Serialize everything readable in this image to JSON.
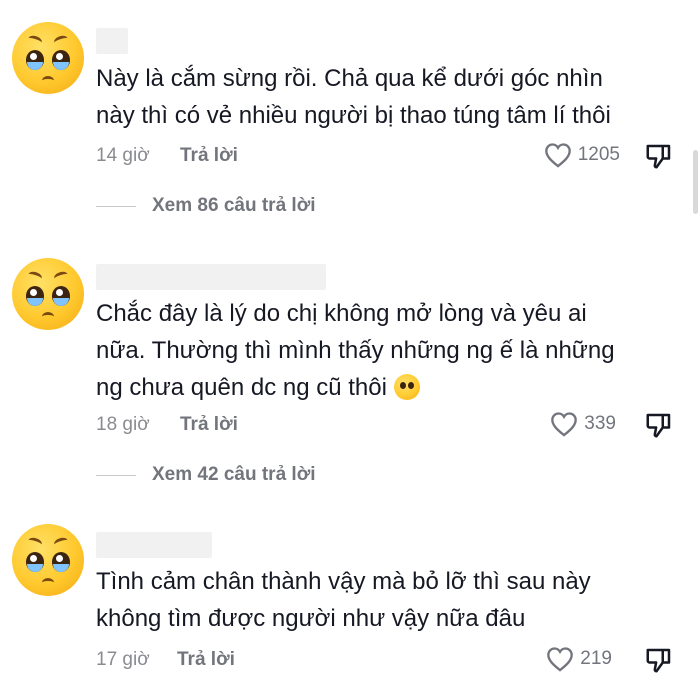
{
  "comments": [
    {
      "lines": [
        "Này là cắm sừng rồi. Chả qua kể dưới góc nhìn",
        "này thì có vẻ nhiều người bị thao túng tâm lí thôi"
      ],
      "time": "14 giờ",
      "reply": "Trả lời",
      "likes": "1205",
      "view_replies": "Xem 86 câu trả lời"
    },
    {
      "lines": [
        "Chắc đây là lý do chị không mở lòng và yêu ai",
        "nữa. Thường thì mình thấy những ng ế là những",
        "ng chưa quên dc ng cũ thôi"
      ],
      "time": "18 giờ",
      "reply": "Trả lời",
      "likes": "339",
      "view_replies": "Xem 42 câu trả lời"
    },
    {
      "lines": [
        "Tình cảm chân thành vậy mà bỏ lỡ thì sau này",
        "không tìm được người như vậy nữa đâu"
      ],
      "time": "17 giờ",
      "reply": "Trả lời",
      "likes": "219"
    }
  ],
  "icons": {
    "like": "heart-outline-icon",
    "dislike": "thumbs-down-icon",
    "avatar": "pleading-face-emoji"
  }
}
